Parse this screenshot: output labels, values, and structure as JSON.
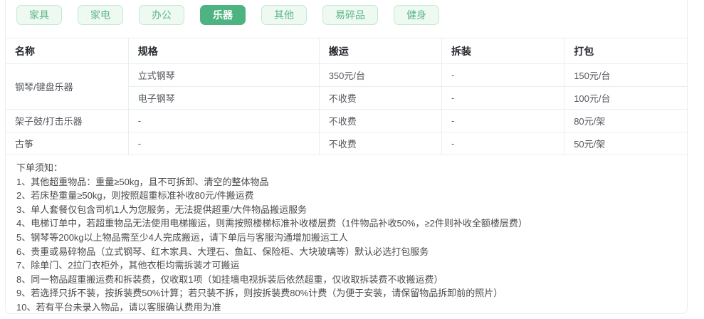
{
  "tabs": [
    {
      "label": "家具",
      "selected": false
    },
    {
      "label": "家电",
      "selected": false
    },
    {
      "label": "办公",
      "selected": false
    },
    {
      "label": "乐器",
      "selected": true
    },
    {
      "label": "其他",
      "selected": false
    },
    {
      "label": "易碎品",
      "selected": false
    },
    {
      "label": "健身",
      "selected": false
    }
  ],
  "table": {
    "headers": [
      "名称",
      "规格",
      "搬运",
      "拆装",
      "打包"
    ],
    "rows": [
      {
        "name": "钢琴/键盘乐器",
        "spec": "立式钢琴",
        "carry": "350元/台",
        "disassemble": "-",
        "pack": "150元/台"
      },
      {
        "spec": "电子钢琴",
        "carry": "不收费",
        "disassemble": "-",
        "pack": "100元/台"
      },
      {
        "name": "架子鼓/打击乐器",
        "spec": "-",
        "carry": "不收费",
        "disassemble": "-",
        "pack": "80元/架"
      },
      {
        "name": "古筝",
        "spec": "-",
        "carry": "不收费",
        "disassemble": "-",
        "pack": "50元/架"
      }
    ]
  },
  "notes": {
    "title": "下单须知：",
    "items": [
      "1、其他超重物品：重量≥50kg，且不可拆卸、清空的整体物品",
      "2、若床垫重量≥50kg，则按照超重标准补收80元/件搬运费",
      "3、单人套餐仅包含司机1人为您服务，无法提供超重/大件物品搬运服务",
      "4、电梯订单中，若超重物品无法使用电梯搬运，则需按照楼梯标准补收楼层费（1件物品补收50%，≥2件则补收全额楼层费）",
      "5、钢琴等200kg以上物品需至少4人完成搬运，请下单后与客服沟通增加搬运工人",
      "6、贵重或易碎物品（立式钢琴、红木家具、大理石、鱼缸、保险柜、大块玻璃等）默认必选打包服务",
      "7、除单门、2拉门衣柜外，其他衣柜均需拆装才可搬运",
      "8、同一物品超重搬运费和拆装费，仅收取1项（如挂墙电视拆装后依然超重，仅收取拆装费不收搬运费）",
      "9、若选择只拆不装，按拆装费50%计算；若只装不拆，则按拆装费80%计费（为便于安装，请保留物品拆卸前的照片）",
      "10、若有平台未录入物品，请以客服确认费用为准"
    ]
  },
  "colors": {
    "accent_green": "#4db381",
    "tab_background": "#eef9f2",
    "tab_border": "#c5e8d4",
    "tab_text": "#5bb687",
    "table_border": "#e9efee"
  }
}
